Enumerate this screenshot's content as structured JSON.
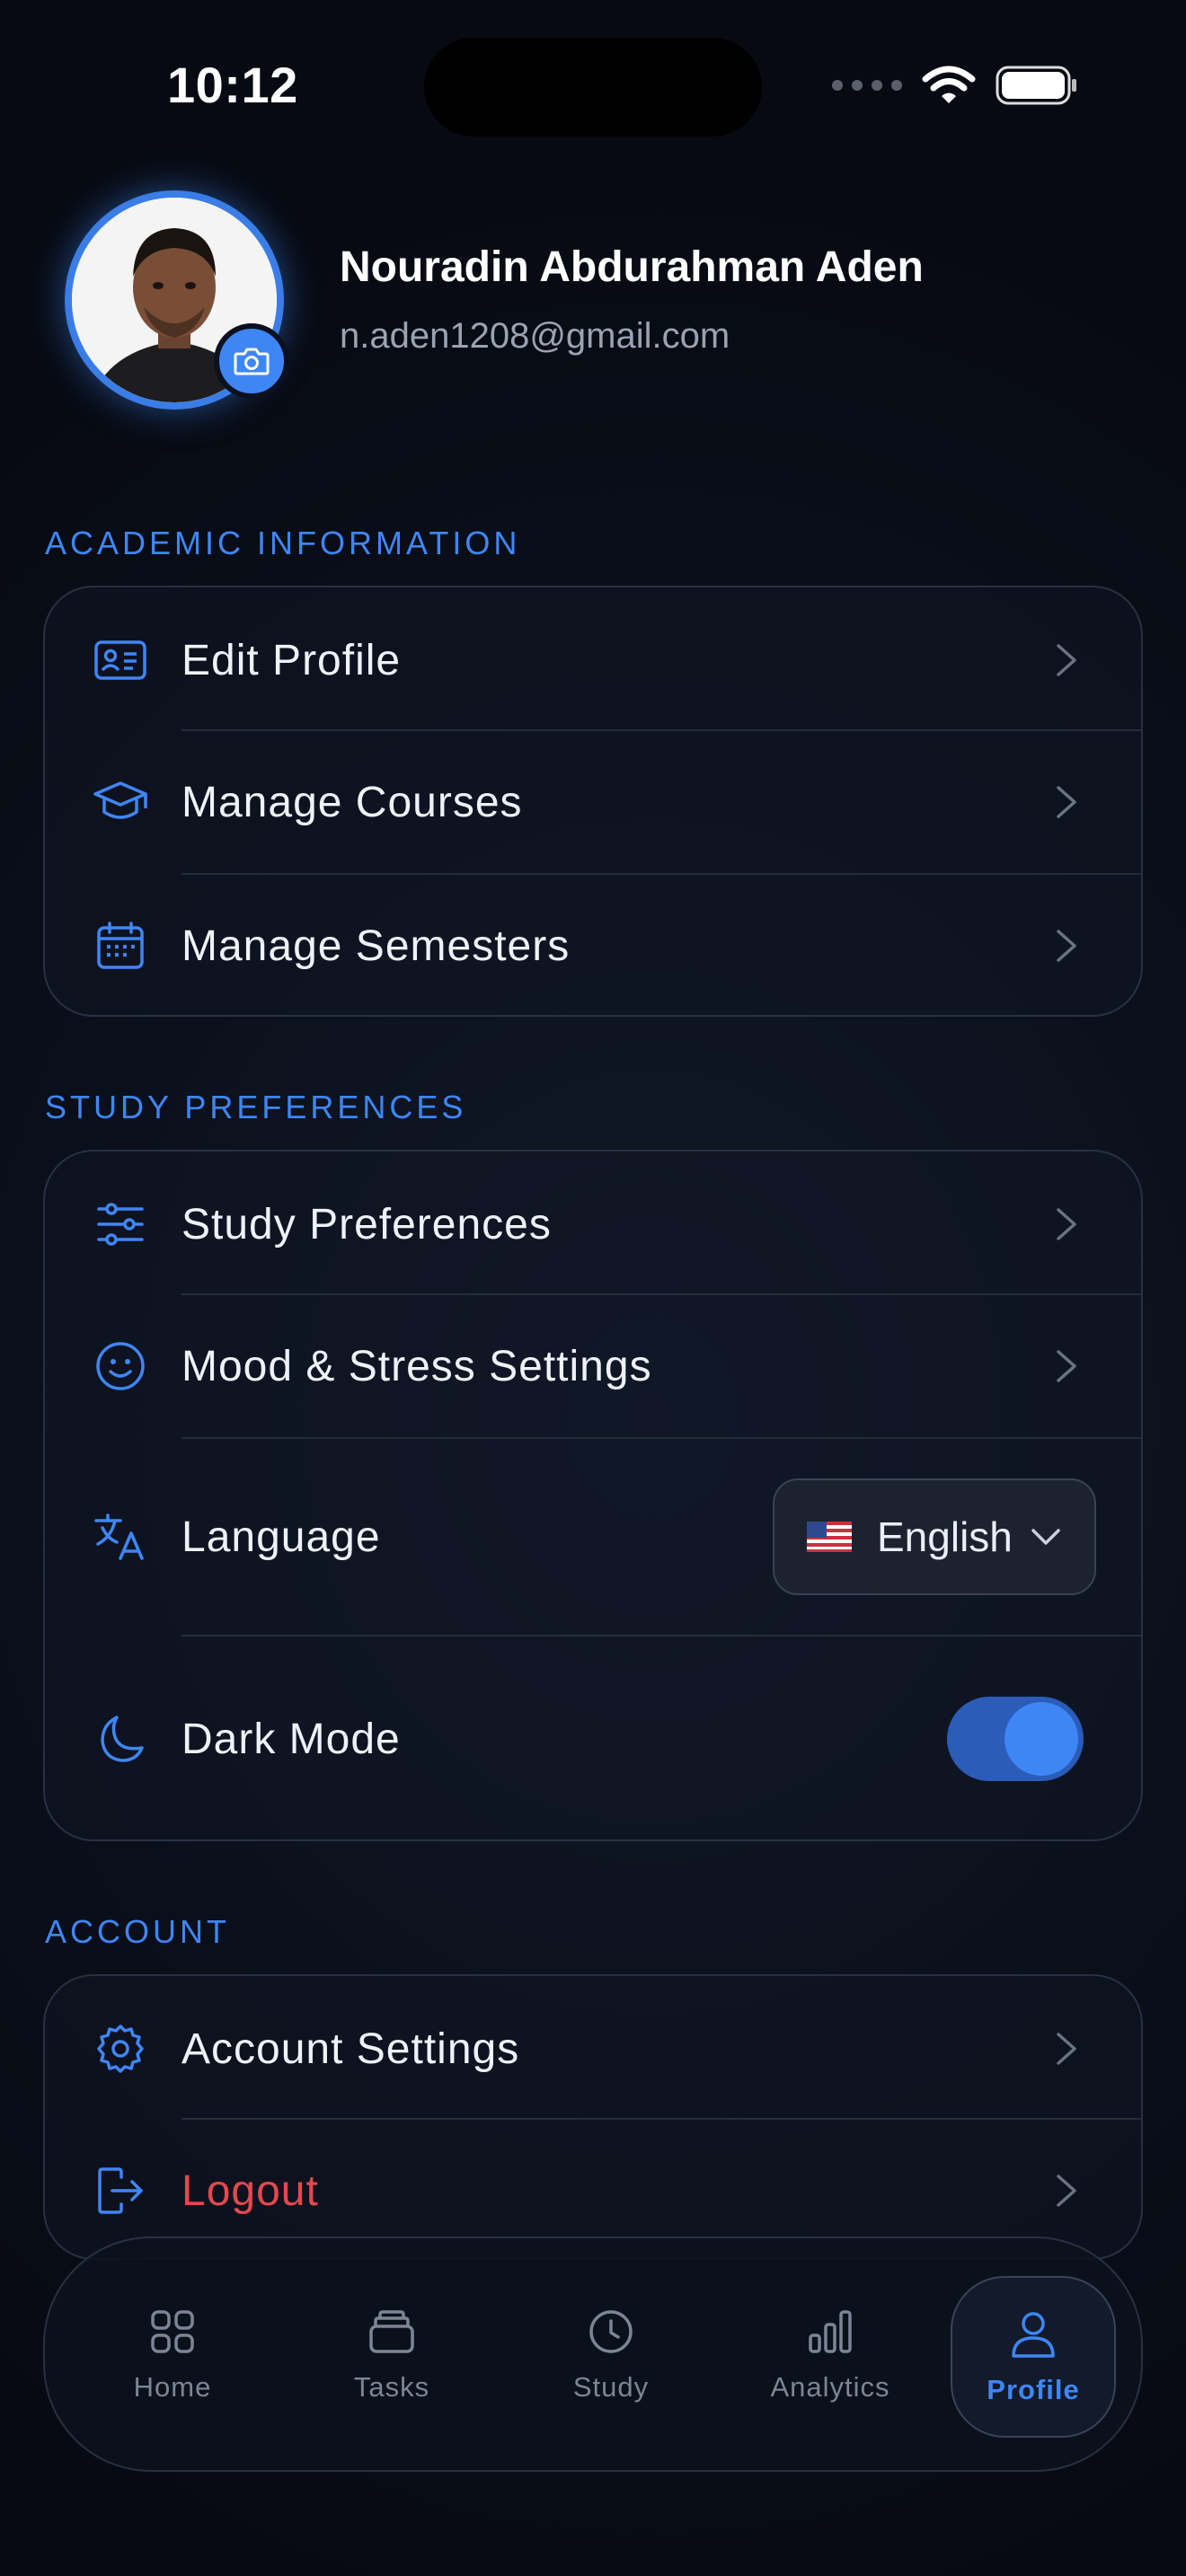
{
  "status_bar": {
    "time": "10:12"
  },
  "profile": {
    "name": "Nouradin Abdurahman Aden",
    "email": "n.aden1208@gmail.com",
    "avatar_icon": "user-photo",
    "camera_icon": "camera-icon"
  },
  "sections": {
    "academic": {
      "title": "ACADEMIC INFORMATION",
      "items": [
        {
          "label": "Edit Profile",
          "icon": "id-card-icon"
        },
        {
          "label": "Manage Courses",
          "icon": "graduation-cap-icon"
        },
        {
          "label": "Manage Semesters",
          "icon": "calendar-icon"
        }
      ]
    },
    "study": {
      "title": "STUDY PREFERENCES",
      "items": [
        {
          "label": "Study Preferences",
          "icon": "sliders-icon"
        },
        {
          "label": "Mood & Stress Settings",
          "icon": "smile-icon"
        },
        {
          "label": "Language",
          "icon": "translate-icon"
        },
        {
          "label": "Dark Mode",
          "icon": "moon-icon"
        }
      ],
      "language_value": "English",
      "language_flag": "🇺🇸",
      "dark_mode_on": true
    },
    "account": {
      "title": "ACCOUNT",
      "items": [
        {
          "label": "Account Settings",
          "icon": "gear-icon"
        },
        {
          "label": "Logout",
          "icon": "logout-icon"
        }
      ]
    }
  },
  "tabbar": {
    "tabs": [
      {
        "label": "Home",
        "icon": "grid-icon"
      },
      {
        "label": "Tasks",
        "icon": "stack-icon"
      },
      {
        "label": "Study",
        "icon": "clock-icon"
      },
      {
        "label": "Analytics",
        "icon": "bar-chart-icon"
      },
      {
        "label": "Profile",
        "icon": "person-icon",
        "active": true
      }
    ]
  },
  "colors": {
    "accent": "#3f86f5",
    "danger": "#e5484d",
    "background": "#0a0f1a",
    "muted_text": "#9aa3b2"
  }
}
